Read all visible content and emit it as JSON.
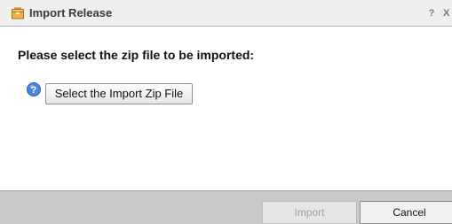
{
  "window": {
    "title": "Import Release",
    "help_label": "?",
    "close_label": "X",
    "icon": "package-icon"
  },
  "main": {
    "prompt": "Please select the zip file to be imported:",
    "help_icon": "help-icon",
    "select_button_label": "Select the Import Zip File"
  },
  "footer": {
    "import_label": "Import",
    "cancel_label": "Cancel",
    "import_disabled": true
  },
  "colors": {
    "accent_icon": "#f0a73a",
    "help_icon": "#4a86d8"
  }
}
